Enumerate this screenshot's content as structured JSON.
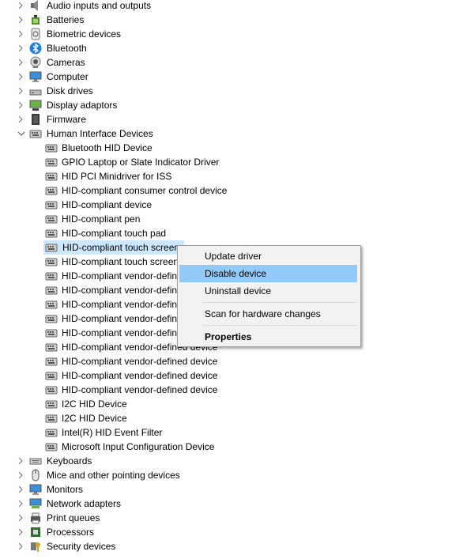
{
  "tree": {
    "categories_top": [
      {
        "label": "Audio inputs and outputs",
        "icon": "speaker-icon"
      },
      {
        "label": "Batteries",
        "icon": "battery-icon"
      },
      {
        "label": "Biometric devices",
        "icon": "biometric-icon"
      },
      {
        "label": "Bluetooth",
        "icon": "bluetooth-icon"
      },
      {
        "label": "Cameras",
        "icon": "camera-icon"
      },
      {
        "label": "Computer",
        "icon": "monitor-icon"
      },
      {
        "label": "Disk drives",
        "icon": "disk-drive-icon"
      },
      {
        "label": "Display adaptors",
        "icon": "display-adapter-icon"
      },
      {
        "label": "Firmware",
        "icon": "firmware-chip-icon"
      }
    ],
    "expanded": {
      "label": "Human Interface Devices",
      "icon": "hid-icon"
    },
    "children": [
      "Bluetooth HID Device",
      "GPIO Laptop or Slate Indicator Driver",
      "HID PCI Minidriver for ISS",
      "HID-compliant consumer control device",
      "HID-compliant device",
      "HID-compliant pen",
      "HID-compliant touch pad",
      "HID-compliant touch screen",
      "HID-compliant touch screen",
      "HID-compliant vendor-defined device",
      "HID-compliant vendor-defined device",
      "HID-compliant vendor-defined device",
      "HID-compliant vendor-defined device",
      "HID-compliant vendor-defined device",
      "HID-compliant vendor-defined device",
      "HID-compliant vendor-defined device",
      "HID-compliant vendor-defined device",
      "HID-compliant vendor-defined device",
      "I2C HID Device",
      "I2C HID Device",
      "Intel(R) HID Event Filter",
      "Microsoft Input Configuration Device"
    ],
    "selected_child_index": 7,
    "categories_bottom": [
      {
        "label": "Keyboards",
        "icon": "keyboard-icon"
      },
      {
        "label": "Mice and other pointing devices",
        "icon": "mouse-icon"
      },
      {
        "label": "Monitors",
        "icon": "monitor-icon"
      },
      {
        "label": "Network adapters",
        "icon": "network-adapter-icon"
      },
      {
        "label": "Print queues",
        "icon": "printer-icon"
      },
      {
        "label": "Processors",
        "icon": "processor-icon"
      },
      {
        "label": "Security devices",
        "icon": "security-key-icon"
      }
    ]
  },
  "context_menu": {
    "items": [
      {
        "label": "Update driver"
      },
      {
        "label": "Disable device",
        "highlighted": true
      },
      {
        "label": "Uninstall device"
      },
      {
        "label": "Scan for hardware changes"
      },
      {
        "label": "Properties",
        "bold": true
      }
    ]
  },
  "colors": {
    "selection": "#cce8ff",
    "menu_highlight": "#91c9f7",
    "menu_bg": "#f2f2f2"
  }
}
